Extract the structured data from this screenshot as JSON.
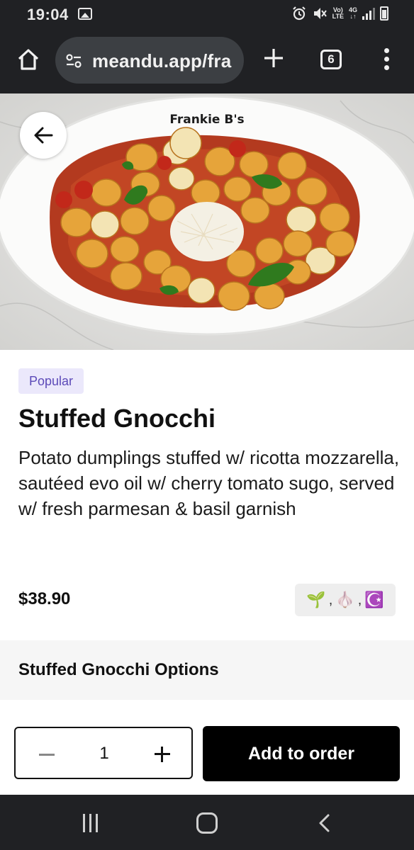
{
  "status_bar": {
    "time": "19:04",
    "volte_label": "Vo)\nLTE",
    "network_label": "4G"
  },
  "browser": {
    "url": "meandu.app/fra",
    "tab_count": "6"
  },
  "hero": {
    "restaurant_name": "Frankie B's"
  },
  "item": {
    "badge": "Popular",
    "title": "Stuffed Gnocchi",
    "description": "Potato dumplings stuffed w/ ricotta mozzarella, sautéed evo oil w/ cherry tomato sugo, served w/ fresh parmesan & basil garnish",
    "price": "$38.90",
    "dietary_icons": [
      "🌱",
      "🧄",
      "☪️"
    ],
    "dietary_separator": ","
  },
  "options": {
    "title": "Stuffed Gnocchi Options"
  },
  "order": {
    "quantity": "1",
    "add_label": "Add to order"
  },
  "colors": {
    "badge_bg": "#ebe8fb",
    "badge_text": "#5c4ab8",
    "primary_button": "#000000",
    "system_bar": "#202124"
  }
}
